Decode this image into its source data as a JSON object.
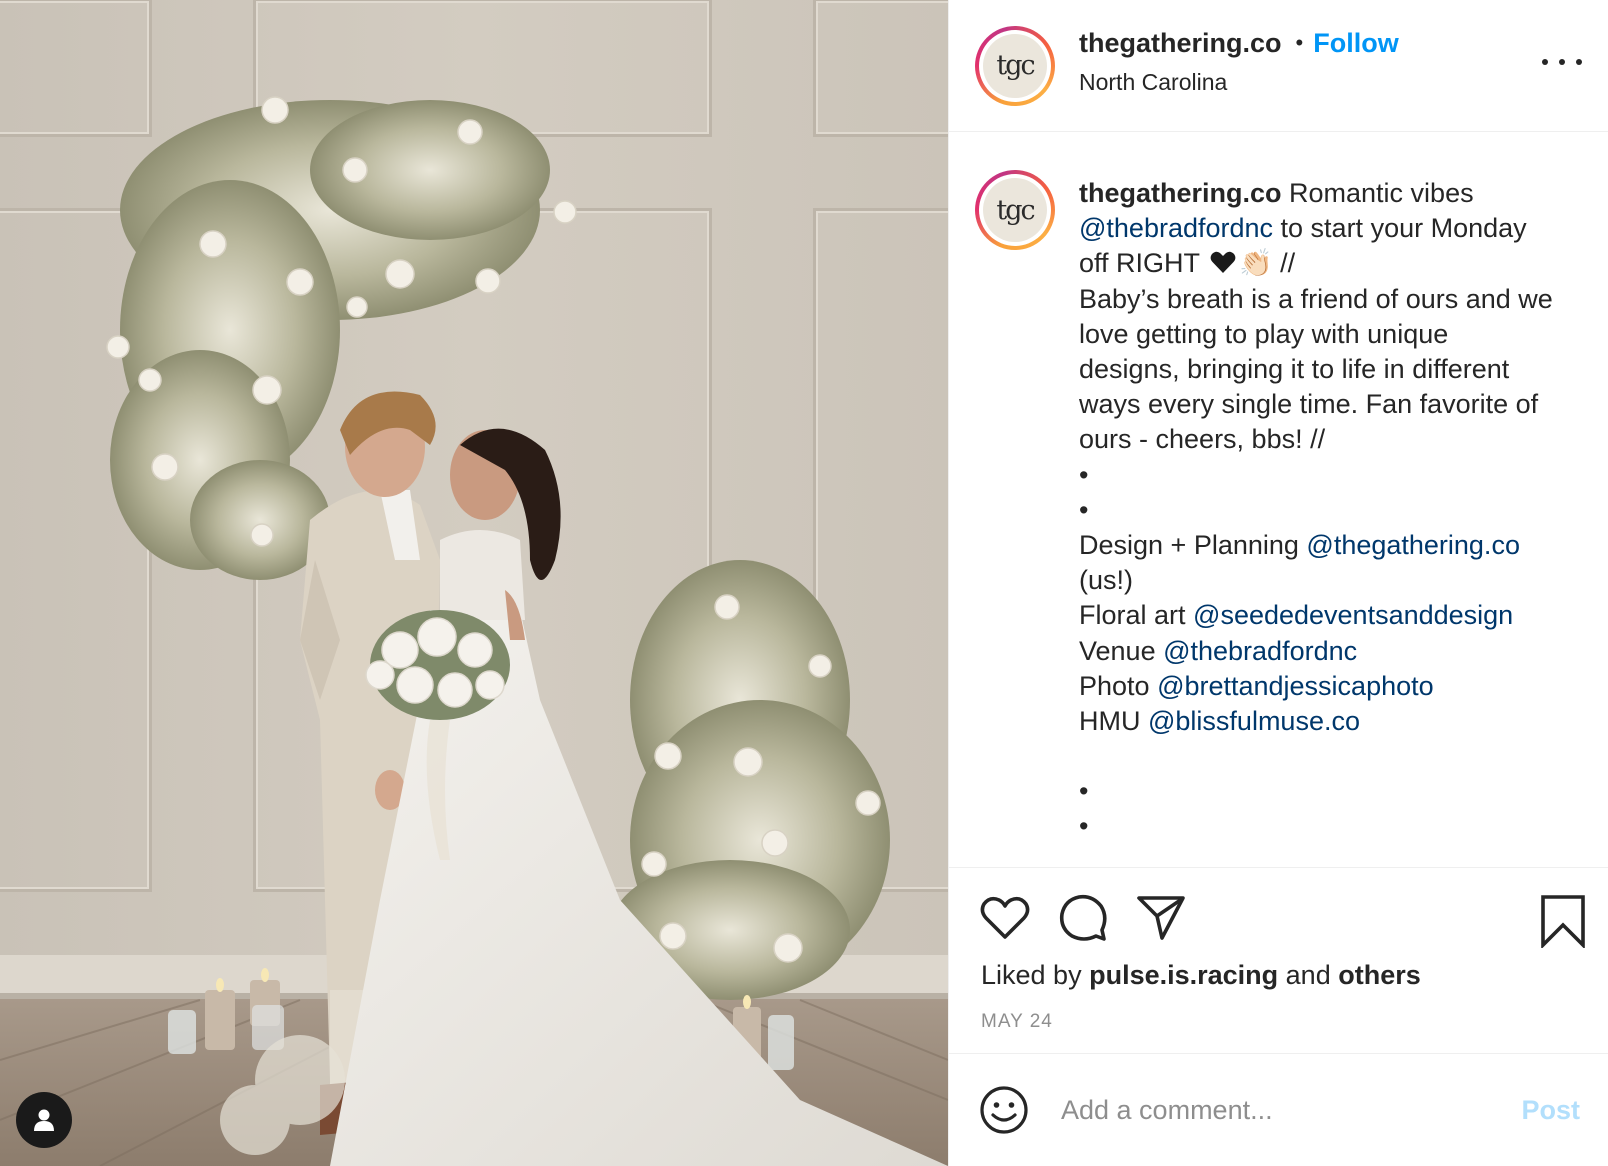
{
  "post": {
    "author": {
      "username": "thegathering.co",
      "avatar_text": "tgc",
      "location": "North Carolina",
      "follow_label": "Follow",
      "separator": "•"
    },
    "caption": {
      "username": "thegathering.co",
      "line1_text": " Romantic vibes",
      "line2_mention": "@thebradfordnc",
      "line2_text": " to start your Monday",
      "line3_text": "off RIGHT ",
      "line3_emoji_hands": "👏🏻",
      "line3_suffix": " //",
      "body_lines": [
        "Baby’s breath is a friend of ours and we",
        "love getting to play with unique",
        "designs, bringing it to life in different",
        "ways every single time. Fan favorite of",
        "ours - cheers, bbs! //"
      ],
      "dot": "•",
      "credits": [
        {
          "label": "Design + Planning ",
          "mention": "@thegathering.co"
        },
        {
          "label": "(us!)",
          "mention": ""
        },
        {
          "label": "Floral art ",
          "mention": "@seededeventsanddesign"
        },
        {
          "label": "Venue ",
          "mention": "@thebradfordnc"
        },
        {
          "label": "Photo ",
          "mention": "@brettandjessicaphoto"
        },
        {
          "label": "HMU ",
          "mention": "@blissfulmuse.co"
        }
      ]
    },
    "likes": {
      "prefix": "Liked by ",
      "user": "pulse.is.racing",
      "middle": " and ",
      "others": "others"
    },
    "date": "MAY 24",
    "comment": {
      "placeholder": "Add a comment...",
      "post_label": "Post"
    }
  },
  "icons": {
    "like": "heart-outline-icon",
    "comment": "speech-bubble-icon",
    "share": "paper-plane-icon",
    "save": "bookmark-icon",
    "emoji": "smiley-icon",
    "more": "ellipsis-icon",
    "tag": "user-icon"
  },
  "colors": {
    "follow": "#0095f6",
    "mention": "#00376b",
    "post_disabled": "#b2dffc",
    "muted": "#8e8e8e"
  }
}
